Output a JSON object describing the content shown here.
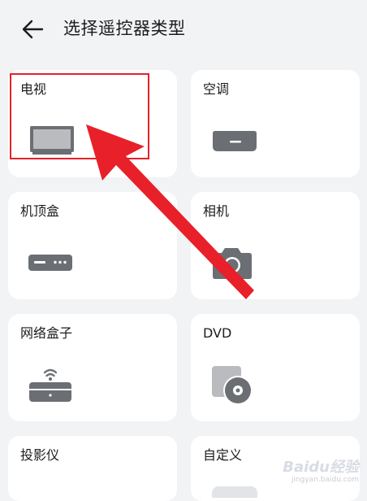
{
  "header": {
    "title": "选择遥控器类型",
    "back_icon": "arrow-left-icon"
  },
  "devices": [
    {
      "label": "电视",
      "icon": "tv-icon"
    },
    {
      "label": "空调",
      "icon": "air-conditioner-icon"
    },
    {
      "label": "机顶盒",
      "icon": "set-top-box-icon"
    },
    {
      "label": "相机",
      "icon": "camera-icon"
    },
    {
      "label": "网络盒子",
      "icon": "network-box-icon"
    },
    {
      "label": "DVD",
      "icon": "dvd-icon"
    },
    {
      "label": "投影仪",
      "icon": "projector-icon"
    },
    {
      "label": "自定义",
      "icon": "custom-icon"
    }
  ],
  "watermark": {
    "logo": "Baidu经验",
    "sub": "jingyan.baidu.com"
  },
  "colors": {
    "background": "#f1f3f5",
    "card": "#ffffff",
    "icon_gray": "#6b6e73",
    "highlight_red": "#e8202a"
  }
}
